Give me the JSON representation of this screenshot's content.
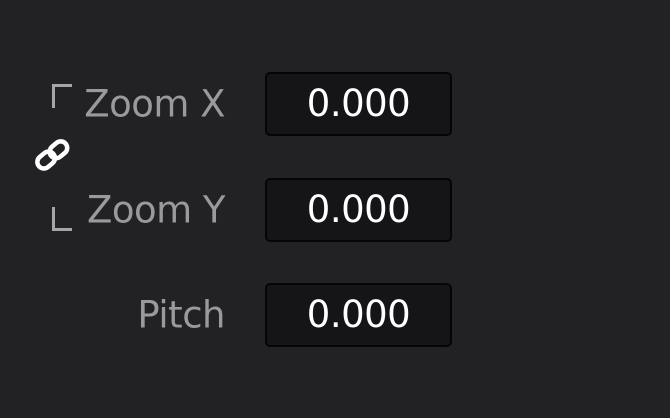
{
  "transform_panel": {
    "link_icon": "chain-link-icon",
    "rows": [
      {
        "label": "Zoom X",
        "value": "0.000"
      },
      {
        "label": "Zoom Y",
        "value": "0.000"
      },
      {
        "label": "Pitch",
        "value": "0.000"
      }
    ]
  },
  "colors": {
    "background": "#222124",
    "label": "#9a9a9d",
    "field_background": "#151417",
    "field_text": "#ffffff"
  }
}
